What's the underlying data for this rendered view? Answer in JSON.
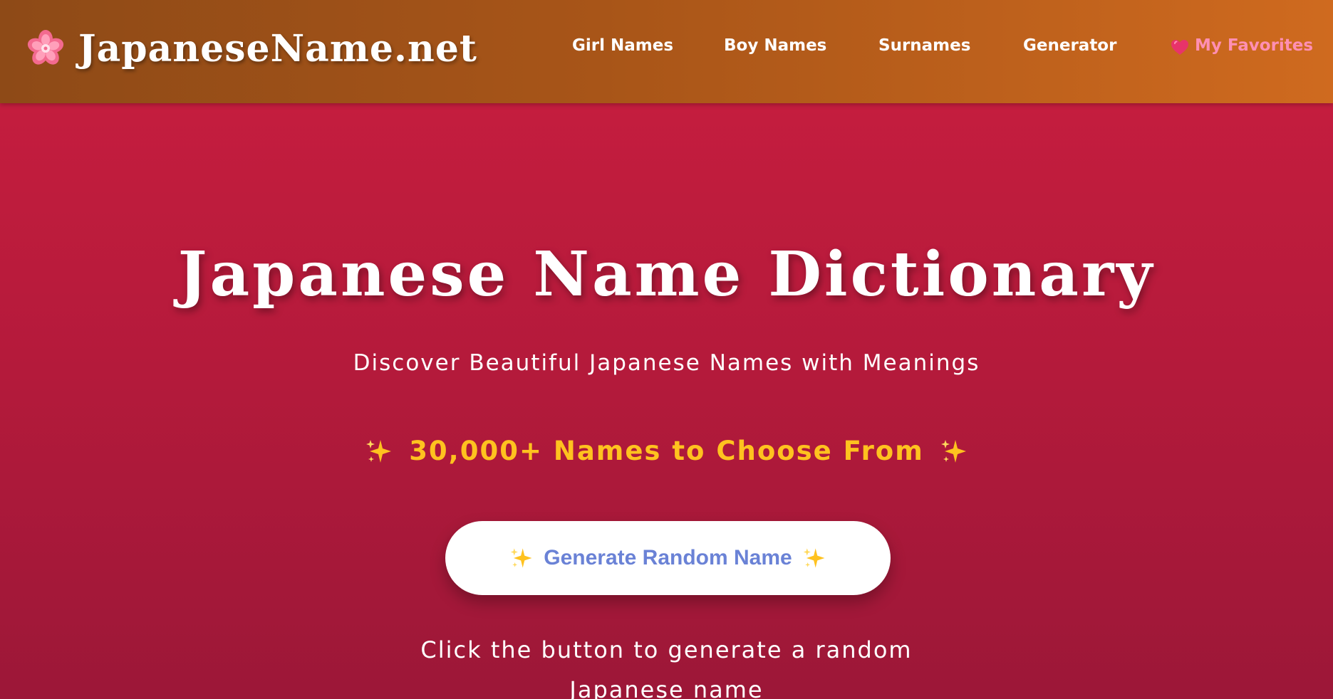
{
  "header": {
    "logo_icon": "cherry-blossom-icon",
    "site_name": "JapaneseName.net",
    "nav": {
      "girl_names": "Girl Names",
      "boy_names": "Boy Names",
      "surnames": "Surnames",
      "generator": "Generator",
      "favorites": "My Favorites",
      "favorites_icon": "heart-icon"
    }
  },
  "hero": {
    "title": "Japanese Name Dictionary",
    "subtitle": "Discover Beautiful Japanese Names with Meanings",
    "count_text": "30,000+ Names to Choose From",
    "count_icon": "sparkles-icon",
    "button_label": "Generate Random Name",
    "hint_line1": "Click the button to generate a random",
    "hint_line2": "Japanese name"
  },
  "colors": {
    "header_gradient_start": "#8e4a17",
    "header_gradient_end": "#cf6a1f",
    "hero_background": "#b41a3b",
    "favorites_text": "#ff8fb3",
    "count_text": "#ffc21f",
    "button_text": "#6a82d6"
  }
}
